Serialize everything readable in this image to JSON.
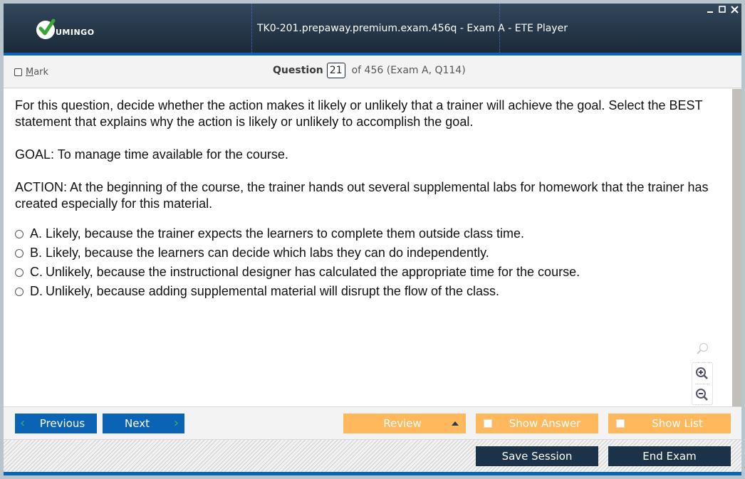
{
  "app": {
    "logo_text": "UMINGO",
    "title": "TK0-201.prepaway.premium.exam.456q - Exam A - ETE Player",
    "window_controls": {
      "minimize": "minimize-icon",
      "maximize": "maximize-icon",
      "close": "close-icon"
    }
  },
  "header": {
    "mark_label_underlined": "M",
    "mark_label_rest": "ark",
    "mark_checked": false,
    "question_label": "Question",
    "question_number": "21",
    "question_rest": "of 456 (Exam A, Q114)"
  },
  "question": {
    "paragraphs": [
      "For this question, decide whether the action makes it likely or unlikely that a trainer will achieve the goal. Select the BEST statement that explains why the action is likely or unlikely to accomplish the goal.",
      "GOAL: To manage time available for the course.",
      "ACTION: At the beginning of the course, the trainer hands out several supplemental labs for homework that the trainer has created especially for this material."
    ],
    "options": [
      {
        "letter": "A.",
        "text": "Likely, because the trainer expects the learners to complete them outside class time.",
        "selected": false
      },
      {
        "letter": "B.",
        "text": "Likely, because the learners can decide which labs they can do independently.",
        "selected": false
      },
      {
        "letter": "C.",
        "text": "Unlikely, because the instructional designer has calculated the appropriate time for the course.",
        "selected": false
      },
      {
        "letter": "D.",
        "text": "Unlikely, because adding supplemental material will disrupt the flow of the class.",
        "selected": false
      }
    ]
  },
  "zoom_tools": {
    "search": "magnifier-icon",
    "zoom_in": "zoom-in-icon",
    "zoom_out": "zoom-out-icon"
  },
  "nav": {
    "previous": "Previous",
    "next": "Next",
    "review": "Review",
    "show_answer": "Show Answer",
    "show_answer_checked": false,
    "show_list": "Show List",
    "show_list_checked": false
  },
  "footer": {
    "save_session": "Save Session",
    "end_exam": "End Exam"
  },
  "colors": {
    "brand_blue": "#0b63b5",
    "title_dark": "#1b2a39",
    "orange": "#ffb85c",
    "dark_button": "#1c3248",
    "chevron_green": "#4caf50"
  }
}
